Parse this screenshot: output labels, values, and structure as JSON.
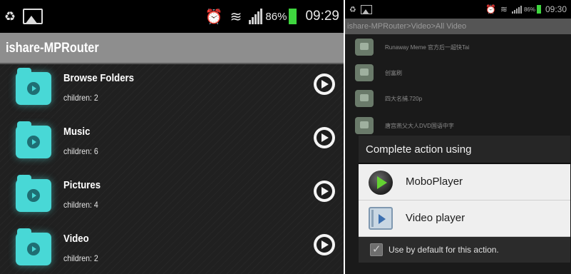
{
  "left": {
    "status": {
      "battery": "86%",
      "time": "09:29"
    },
    "app_title": "ishare-MPRouter",
    "items": [
      {
        "name": "Browse Folders",
        "children": "children: 2"
      },
      {
        "name": "Music",
        "children": "children: 6"
      },
      {
        "name": "Pictures",
        "children": "children: 4"
      },
      {
        "name": "Video",
        "children": "children: 2"
      }
    ]
  },
  "right": {
    "status": {
      "battery": "86%",
      "time": "09:30"
    },
    "breadcrumb": "ishare-MPRouter>Video>All Video",
    "videos": [
      "Runaway Meme 官方后一超快Tai",
      "创富刷",
      "四大名捕.720p",
      "唐宫燕父大人DVD国语中字"
    ],
    "dialog": {
      "title": "Complete action using",
      "options": [
        {
          "label": "MoboPlayer",
          "icon": "moboplayer-icon"
        },
        {
          "label": "Video player",
          "icon": "video-player-icon"
        }
      ],
      "default_label": "Use by default for this action."
    }
  },
  "colors": {
    "folder": "#48d8d6",
    "title_bar": "#8e8e8e",
    "battery": "#3fd63f",
    "mobo_play": "#64d232"
  }
}
